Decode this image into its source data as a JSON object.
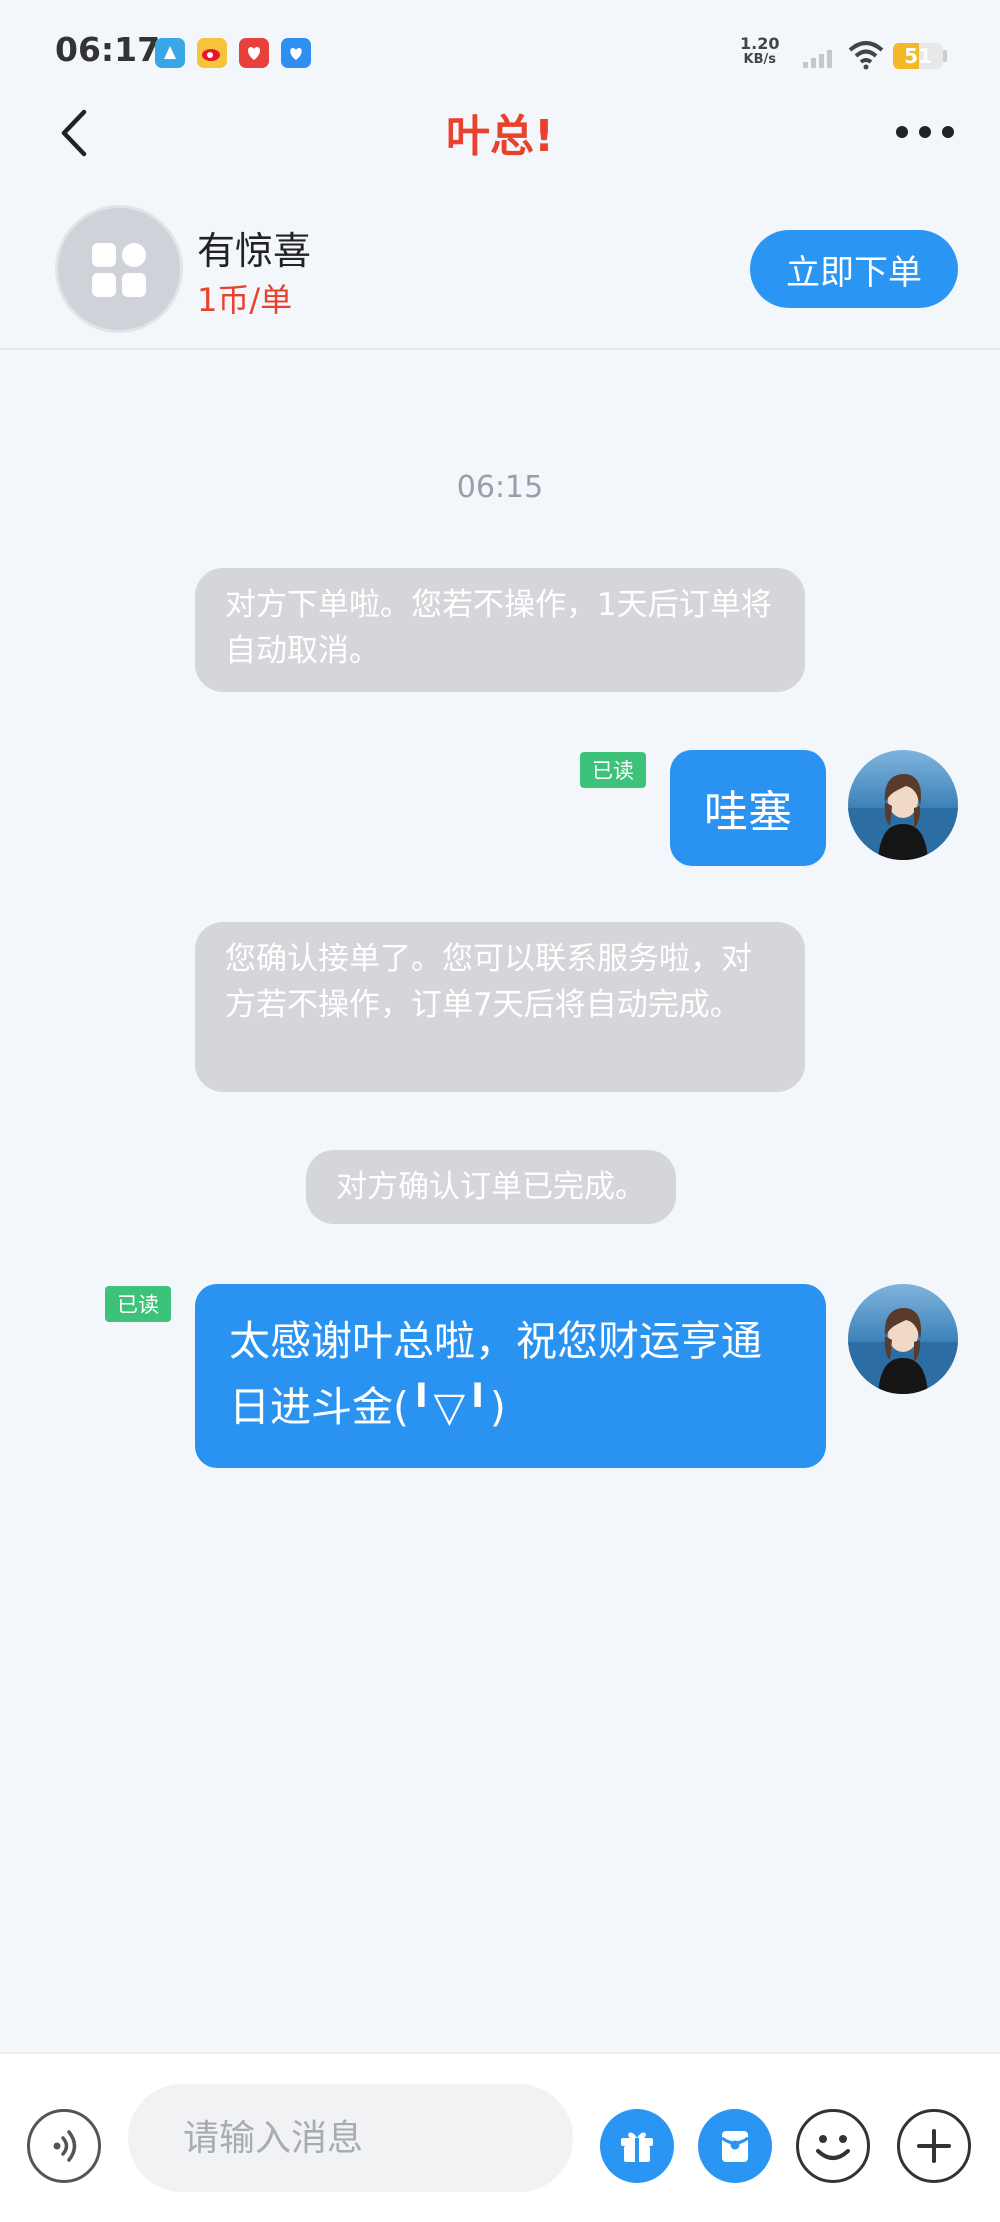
{
  "status_bar": {
    "time": "06:17",
    "net_speed_value": "1.20",
    "net_speed_unit": "KB/s",
    "battery": "51",
    "battery_level": 0.51
  },
  "nav": {
    "title": "叶总!"
  },
  "order": {
    "title": "有惊喜",
    "price": "1币/单",
    "button_label": "立即下单"
  },
  "chat": {
    "timestamp": "06:15",
    "messages": [
      {
        "type": "system",
        "text": "对方下单啦。您若不操作，1天后订单将自动取消。"
      },
      {
        "type": "mine",
        "text": "哇塞",
        "read_label": "已读"
      },
      {
        "type": "system",
        "text": "您确认接单了。您可以联系服务啦，对方若不操作，订单7天后将自动完成。"
      },
      {
        "type": "system",
        "text": "对方确认订单已完成。"
      },
      {
        "type": "mine",
        "text": "太感谢叶总啦，祝您财运亨通日进斗金(╹▽╹)",
        "read_label": "已读"
      }
    ]
  },
  "input": {
    "placeholder": "请输入消息"
  },
  "colors": {
    "accent": "#2b95f3",
    "title_red": "#e8412c",
    "read_green": "#3dc27a",
    "system_bubble": "#d4d6da"
  },
  "icons": [
    "back-icon",
    "more-icon",
    "app-grid-icon",
    "voice-icon",
    "gift-icon",
    "red-packet-icon",
    "emoji-icon",
    "plus-icon"
  ]
}
